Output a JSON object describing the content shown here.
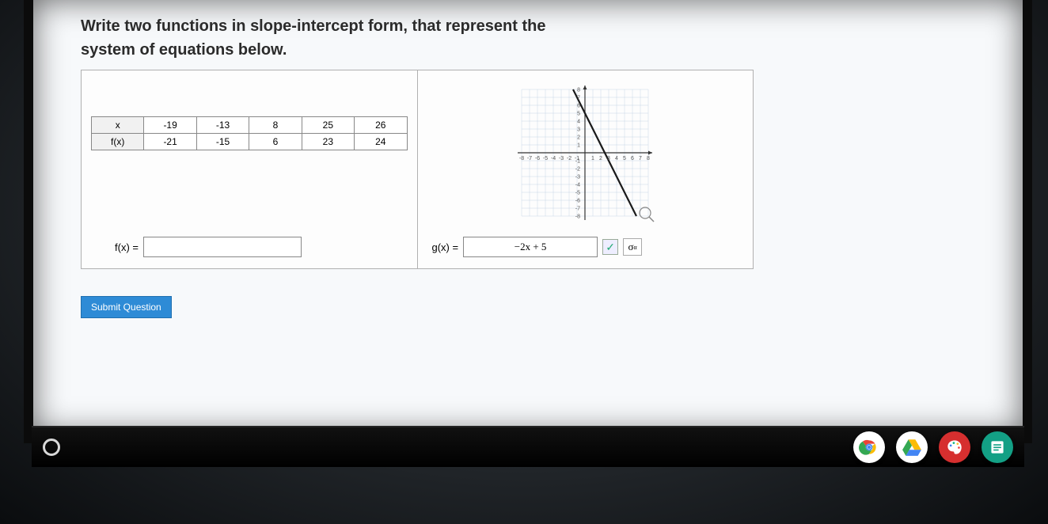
{
  "prompt_line1": "Write two functions in slope-intercept form, that represent the",
  "prompt_line2": "system of equations below.",
  "table": {
    "row_labels": [
      "x",
      "f(x)"
    ],
    "x": [
      "-19",
      "-13",
      "8",
      "25",
      "26"
    ],
    "fx": [
      "-21",
      "-15",
      "6",
      "23",
      "24"
    ]
  },
  "fx_label": "f(x) =",
  "gx_label": "g(x) =",
  "fx_value": "",
  "gx_value": "−2x + 5",
  "sigma_label": "σ",
  "submit_label": "Submit Question",
  "chart_data": {
    "type": "line",
    "title": "",
    "xlabel": "",
    "ylabel": "",
    "xlim": [
      -8,
      8
    ],
    "ylim": [
      -8,
      8
    ],
    "xticks": [
      -8,
      -7,
      -6,
      -5,
      -4,
      -3,
      -2,
      -1,
      1,
      2,
      3,
      4,
      5,
      6,
      7,
      8
    ],
    "yticks": [
      -8,
      -7,
      -6,
      -5,
      -4,
      -3,
      -2,
      -1,
      1,
      2,
      3,
      4,
      5,
      6,
      7,
      8
    ],
    "series": [
      {
        "name": "g(x) = -2x + 5",
        "points": [
          [
            -1.5,
            8
          ],
          [
            0,
            5
          ],
          [
            2.5,
            0
          ],
          [
            6.5,
            -8
          ]
        ]
      }
    ],
    "grid": true
  },
  "icons": {
    "check": "✓",
    "sigma_sup": "α"
  }
}
